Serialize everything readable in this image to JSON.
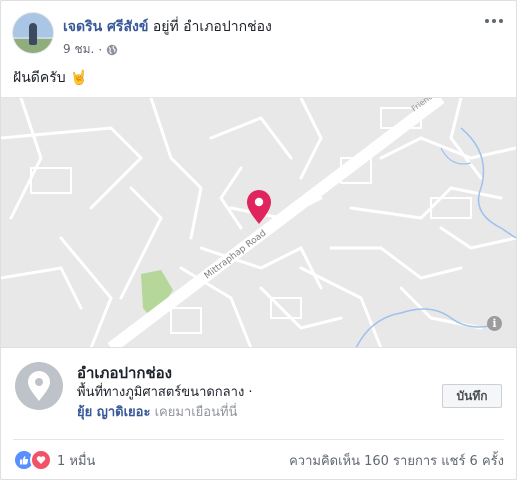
{
  "post": {
    "author_name": "เจดริน ศรีสังข์",
    "location_text": " อยู่ที่ อำเภอปากช่อง",
    "time": "9 ชม.",
    "dot": " · ",
    "text": "ฝันดีครับ 🤘"
  },
  "map": {
    "road_label": "Mittraphap Road",
    "road_label_top": "Friend",
    "info_label": "i"
  },
  "place": {
    "name": "อำเภอปากช่อง",
    "category": "พื้นที่ทางภูมิศาสตร์ขนาดกลาง ·",
    "visitor_name": "ยุ้ย ญาดิเยอะ",
    "visitor_suffix": " เคยมาเยือนที่นี่",
    "save_label": "บันทึก"
  },
  "footer": {
    "reaction_count": "1 หมื่น",
    "stats": "ความคิดเห็น 160 รายการ  แชร์ 6 ครั้ง"
  },
  "colors": {
    "link": "#385898",
    "pin": "#e0245e",
    "like": "#5890ff",
    "love": "#f25268"
  },
  "icons": [
    "globe-icon",
    "more-options-icon",
    "map-pin-icon",
    "location-pin-icon",
    "like-reaction-icon",
    "love-reaction-icon",
    "info-icon"
  ]
}
